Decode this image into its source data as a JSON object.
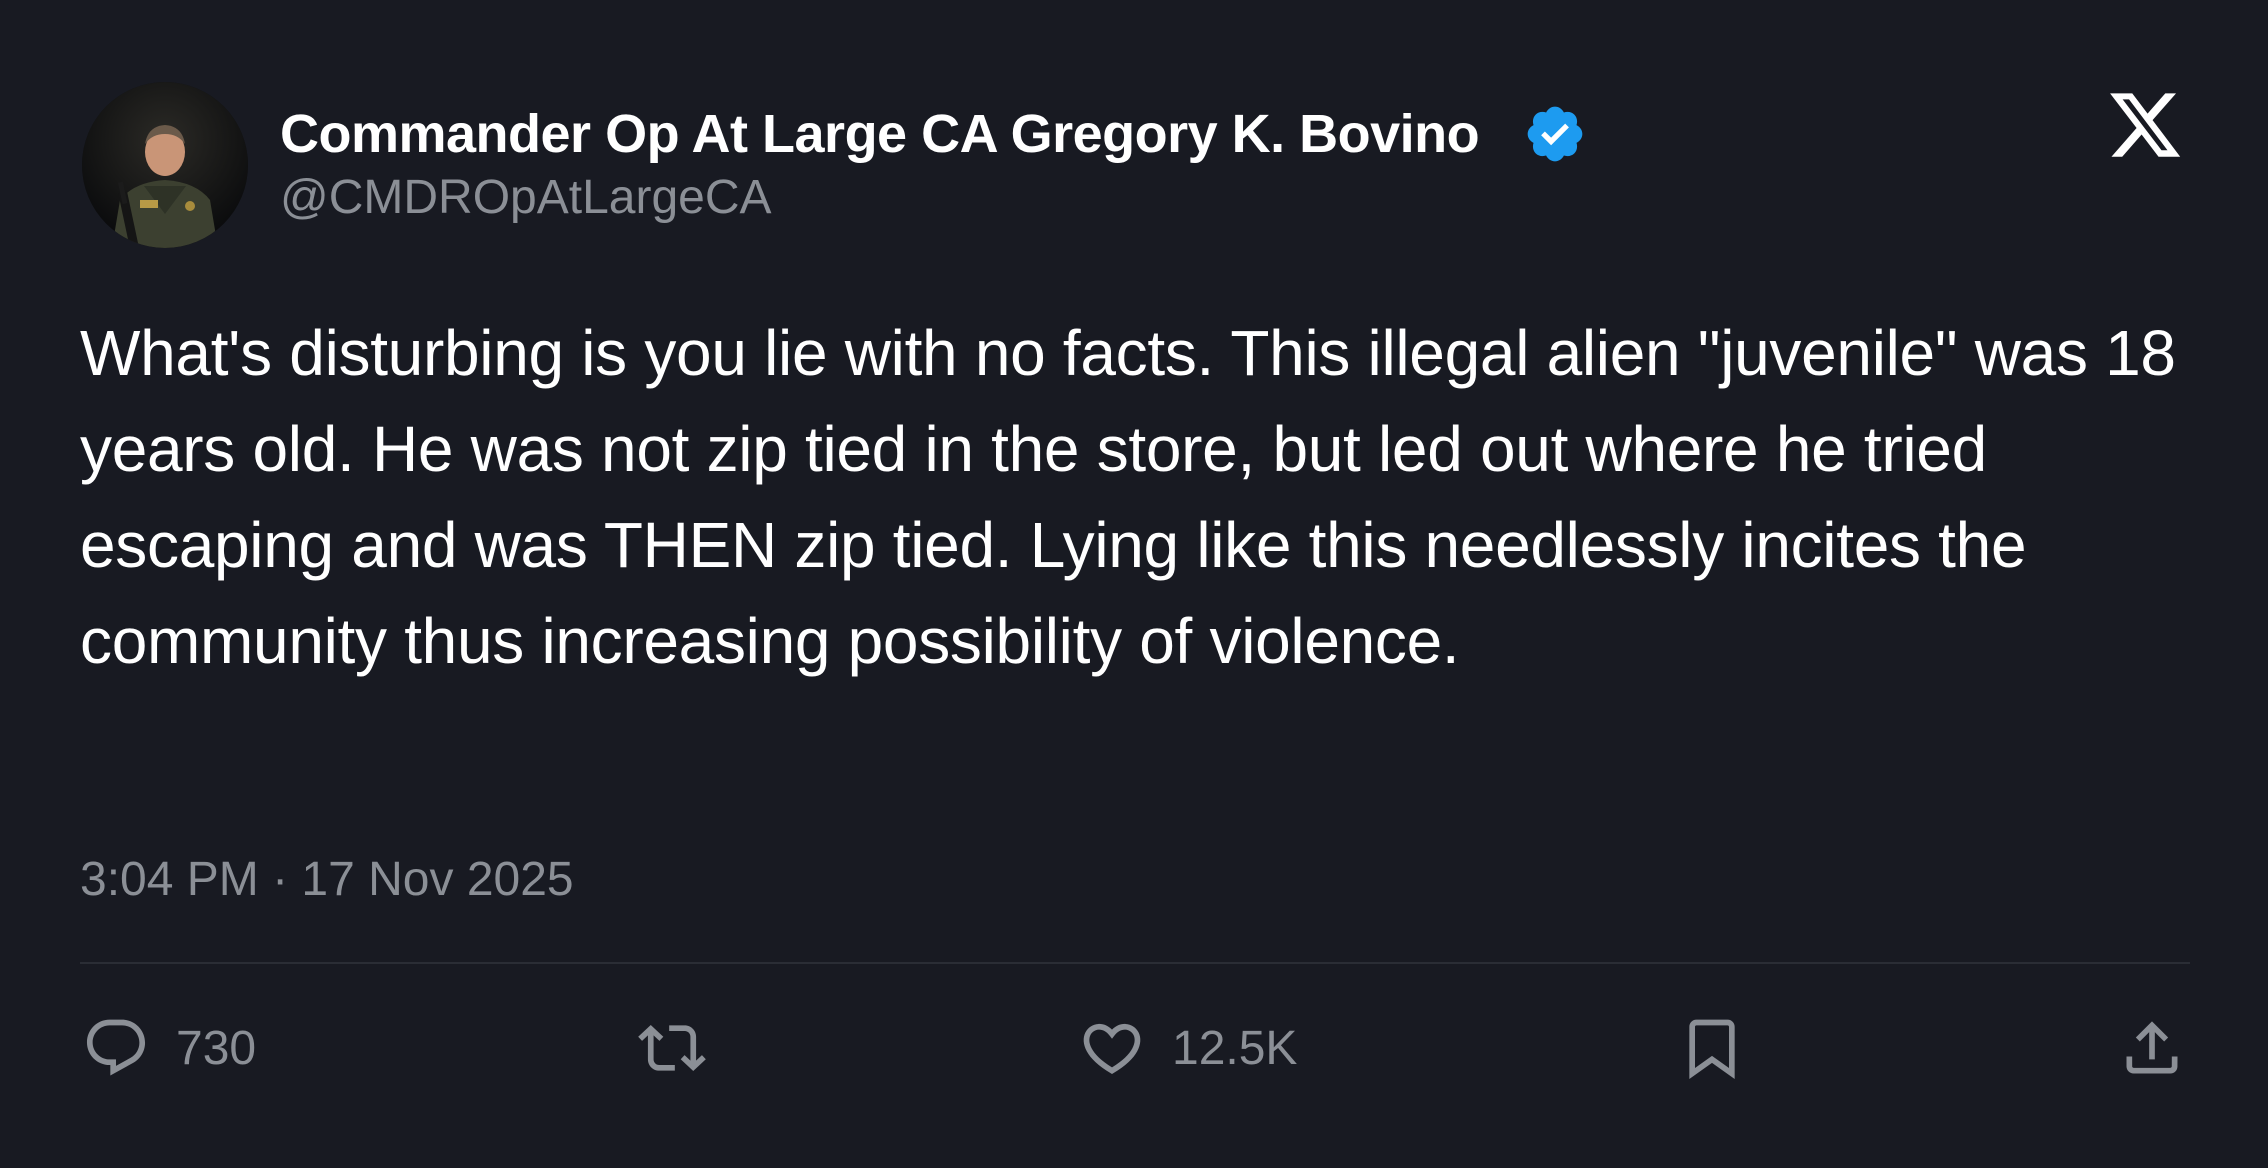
{
  "author": {
    "display_name": "Commander Op At Large CA Gregory K. Bovino",
    "handle": "@CMDROpAtLargeCA",
    "verified": true,
    "verified_color": "#1d9bf0"
  },
  "tweet": {
    "text": "What's disturbing is you lie with no facts. This illegal alien \"juvenile\" was 18 years old. He was not zip tied in the store, but led out where he tried escaping and was THEN zip tied. Lying like this needlessly incites the community thus increasing possibility of violence.",
    "timestamp": "3:04 PM · 17 Nov 2025"
  },
  "actions": {
    "reply_count": "730",
    "like_count": "12.5K"
  },
  "icons": {
    "platform": "x-logo-icon",
    "reply": "comment-bubble-icon",
    "retweet": "retweet-icon",
    "like": "heart-icon",
    "bookmark": "bookmark-icon",
    "share": "share-upload-icon"
  },
  "colors": {
    "background": "#181a22",
    "text_primary": "#ffffff",
    "text_secondary": "#8b8f96",
    "divider": "#2a2d35"
  }
}
